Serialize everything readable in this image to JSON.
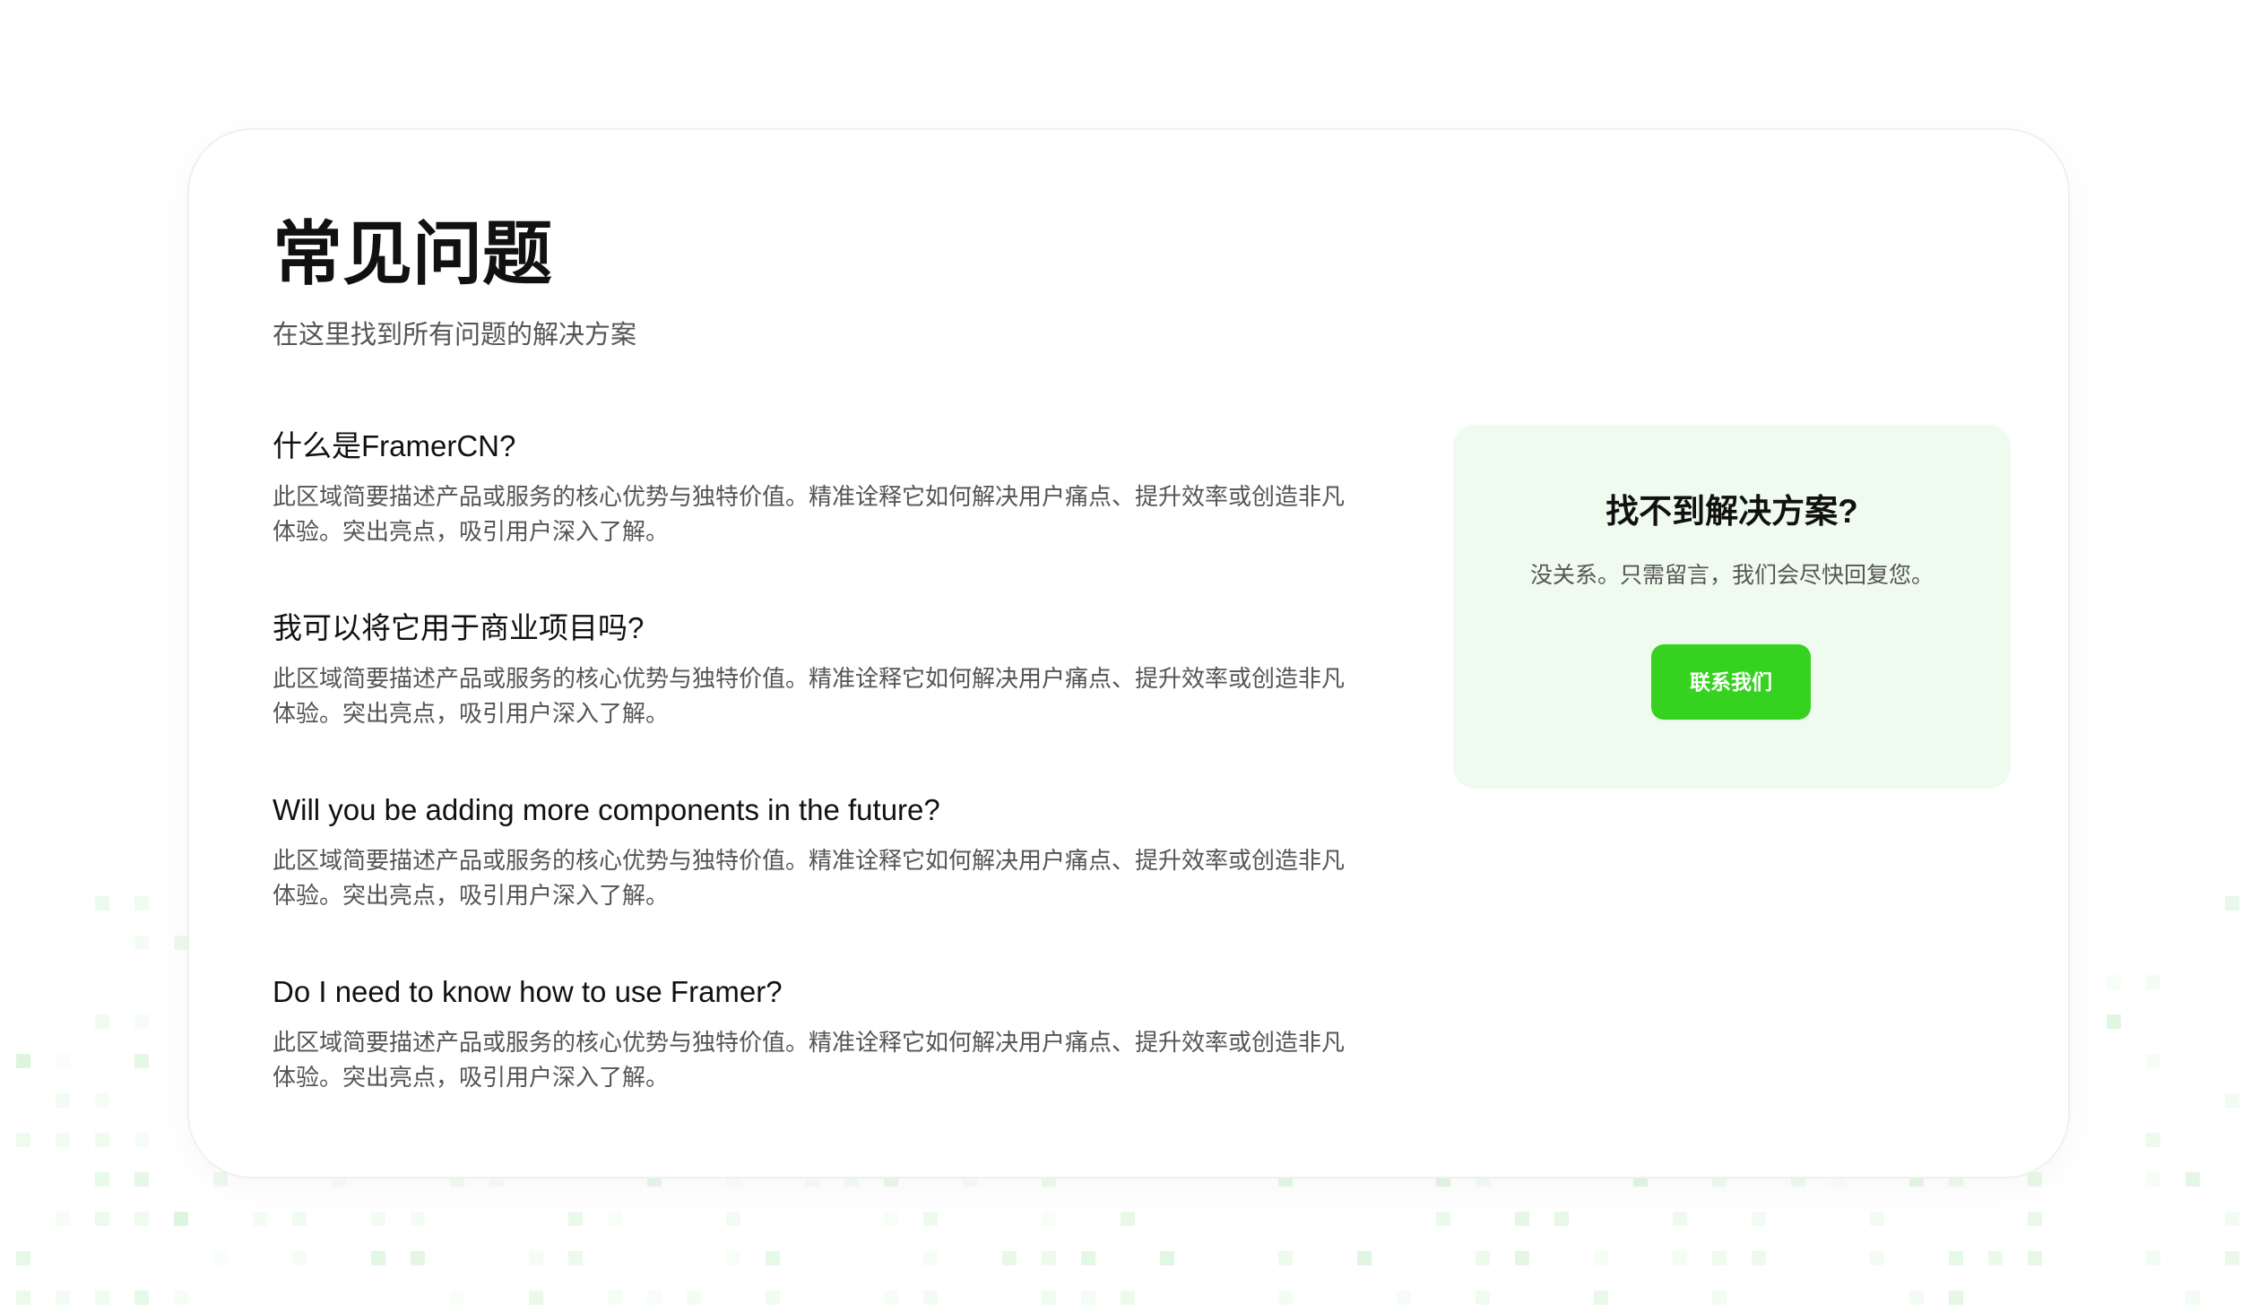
{
  "faq": {
    "title": "常见问题",
    "subtitle": "在这里找到所有问题的解决方案",
    "items": [
      {
        "question": "什么是FramerCN?",
        "answer": "此区域简要描述产品或服务的核心优势与独特价值。精准诠释它如何解决用户痛点、提升效率或创造非凡体验。突出亮点，吸引用户深入了解。"
      },
      {
        "question": "我可以将它用于商业项目吗?",
        "answer": "此区域简要描述产品或服务的核心优势与独特价值。精准诠释它如何解决用户痛点、提升效率或创造非凡体验。突出亮点，吸引用户深入了解。"
      },
      {
        "question": "Will you be adding more components in the future?",
        "answer": "此区域简要描述产品或服务的核心优势与独特价值。精准诠释它如何解决用户痛点、提升效率或创造非凡体验。突出亮点，吸引用户深入了解。"
      },
      {
        "question": "Do I need to know how to use Framer?",
        "answer": "此区域简要描述产品或服务的核心优势与独特价值。精准诠释它如何解决用户痛点、提升效率或创造非凡体验。突出亮点，吸引用户深入了解。"
      }
    ]
  },
  "help_panel": {
    "title": "找不到解决方案?",
    "text": "没关系。只需留言，我们会尽快回复您。",
    "button_label": "联系我们"
  },
  "colors": {
    "accent_green": "#35d21f",
    "panel_background": "#f0fbf0",
    "text_primary": "#111111",
    "text_secondary": "#555555"
  }
}
